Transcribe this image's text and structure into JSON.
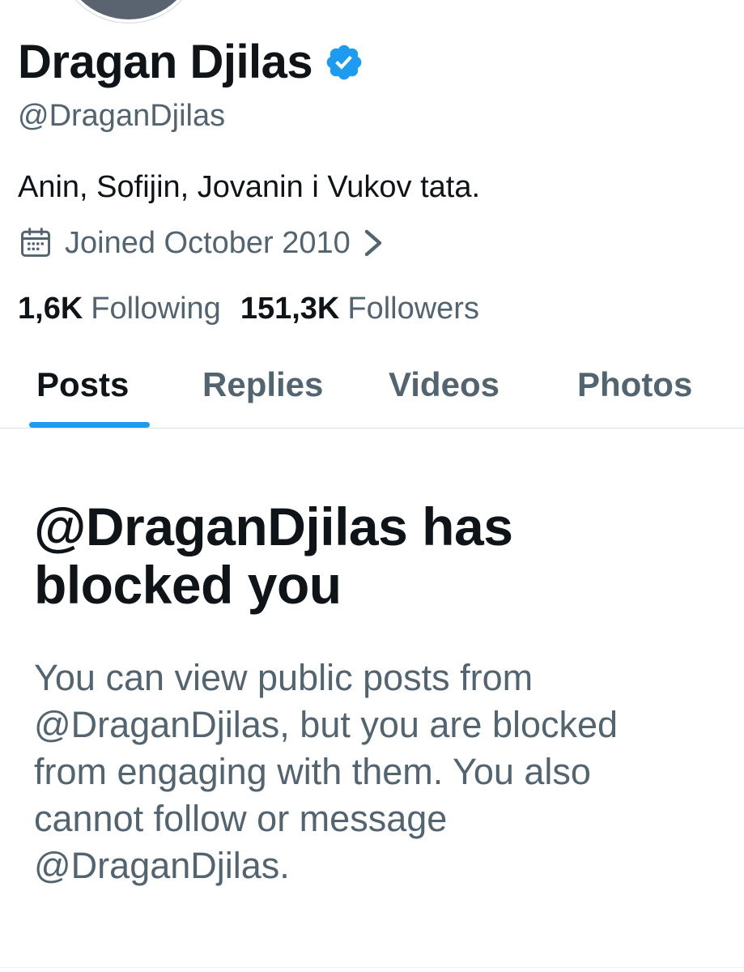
{
  "profile": {
    "display_name": "Dragan Djilas",
    "handle": "@DraganDjilas",
    "bio": "Anin, Sofijin, Jovanin i Vukov tata.",
    "joined": "Joined October 2010",
    "following_count": "1,6K",
    "following_label": "Following",
    "followers_count": "151,3K",
    "followers_label": "Followers",
    "verified_color": "#1d9bf0"
  },
  "tabs": [
    {
      "label": "Posts",
      "active": true
    },
    {
      "label": "Replies",
      "active": false
    },
    {
      "label": "Videos",
      "active": false
    },
    {
      "label": "Photos",
      "active": false
    }
  ],
  "block_notice": {
    "title": "@DraganDjilas has blocked you",
    "message": "You can view public posts from @DraganDjilas, but you are blocked from engaging with them. You also cannot follow or message @DraganDjilas."
  },
  "colors": {
    "text_primary": "#0f1419",
    "text_secondary": "#536471",
    "accent": "#1d9bf0",
    "divider": "#d8dde1"
  }
}
